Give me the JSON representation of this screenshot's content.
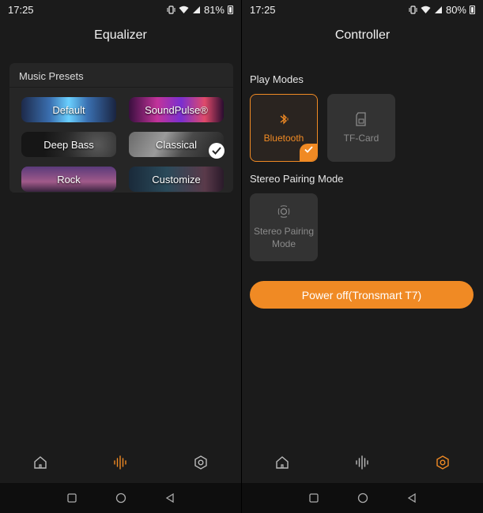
{
  "status_left": {
    "time": "17:25",
    "battery": "81%"
  },
  "status_right": {
    "time": "17:25",
    "battery": "80%"
  },
  "equalizer": {
    "title": "Equalizer",
    "presets_label": "Music Presets",
    "presets": [
      {
        "label": "Default",
        "selected": false
      },
      {
        "label": "SoundPulse®",
        "selected": false
      },
      {
        "label": "Deep Bass",
        "selected": false
      },
      {
        "label": "Classical",
        "selected": true
      },
      {
        "label": "Rock",
        "selected": false
      },
      {
        "label": "Customize",
        "selected": false
      }
    ]
  },
  "controller": {
    "title": "Controller",
    "play_modes_label": "Play Modes",
    "modes": [
      {
        "label": "Bluetooth",
        "active": true,
        "icon": "bluetooth-icon"
      },
      {
        "label": "TF-Card",
        "active": false,
        "icon": "sd-card-icon"
      }
    ],
    "stereo_label": "Stereo Pairing Mode",
    "stereo_button": "Stereo Pairing Mode",
    "power_button": "Power off(Tronsmart T7)"
  },
  "colors": {
    "accent": "#f08a24",
    "background": "#1b1b1b",
    "card": "#262626"
  },
  "nav_icons": [
    "home-icon",
    "equalizer-icon",
    "settings-icon"
  ]
}
